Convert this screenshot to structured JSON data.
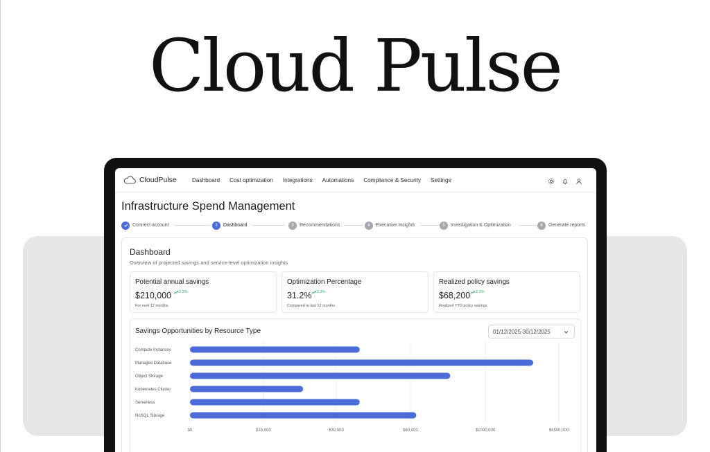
{
  "hero": {
    "title": "Cloud Pulse"
  },
  "nav": {
    "brand": "CloudPulse",
    "menu": [
      "Dashboard",
      "Cost optimization",
      "Integrations",
      "Automations",
      "Compliance & Security",
      "Settings"
    ],
    "icons": [
      "gear-icon",
      "bell-icon",
      "user-icon"
    ]
  },
  "page": {
    "title": "Infrastructure Spend Management"
  },
  "stepper": {
    "steps": [
      {
        "num": "",
        "label": "Connect account",
        "state": "done"
      },
      {
        "num": "2",
        "label": "Dashboard",
        "state": "active"
      },
      {
        "num": "3",
        "label": "Recommendations",
        "state": "todo"
      },
      {
        "num": "4",
        "label": "Executive Insights",
        "state": "todo"
      },
      {
        "num": "5",
        "label": "Investigation & Optimization",
        "state": "todo"
      },
      {
        "num": "6",
        "label": "Generate reports",
        "state": "todo"
      }
    ]
  },
  "dashboard": {
    "title": "Dashboard",
    "subtitle": "Overview of projected savings and service-level optimization insights",
    "metrics": [
      {
        "label": "Potential annual savings",
        "value": "$210,000",
        "delta": "2.3%",
        "note": "For next 12 months"
      },
      {
        "label": "Optimization Percentage",
        "value": "31.2%",
        "delta": "2.3%",
        "note": "Compared to last 12 months"
      },
      {
        "label": "Realized policy savings",
        "value": "$68,200",
        "delta": "2.3%",
        "note": "Realized YTD policy savings"
      }
    ],
    "chart": {
      "title": "Savings Opportunities by Resource Type",
      "date_range": "01/12/2025-30/12/2025"
    }
  },
  "colors": {
    "accent": "#4a6bd8",
    "positive": "#27ae60"
  },
  "chart_data": {
    "type": "bar",
    "orientation": "horizontal",
    "title": "Savings Opportunities by Resource Type",
    "categories": [
      "Compute Instances",
      "Managed Database",
      "Object Storage",
      "Kubernetes Cluster",
      "Serverless",
      "NoSQL Storage"
    ],
    "values": [
      0.45,
      0.91,
      0.69,
      0.3,
      0.45,
      0.6
    ],
    "value_unit": "fraction of axis span",
    "x_tick_labels": [
      "$0",
      "$15,000",
      "$30,000",
      "$60,000",
      "$1000,000",
      "$1500,000"
    ],
    "grid": true
  }
}
